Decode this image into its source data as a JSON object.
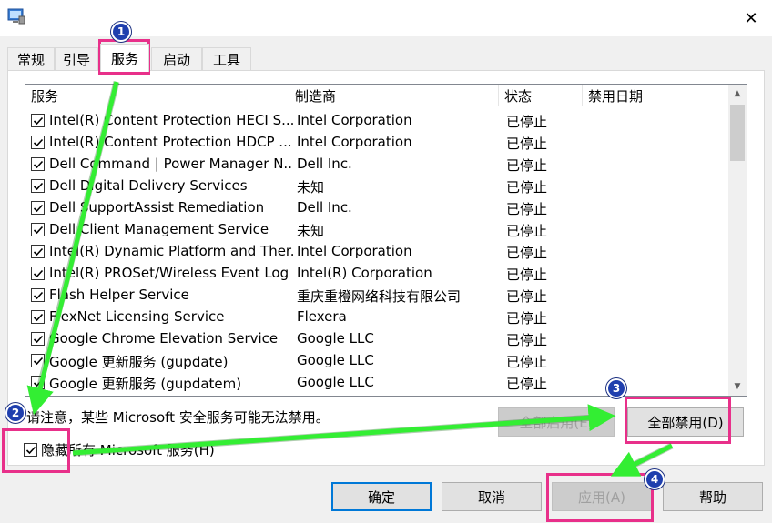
{
  "titlebar": {
    "close_glyph": "✕",
    "icon": "msconfig-icon"
  },
  "tabs": [
    {
      "label": "常规",
      "active": false
    },
    {
      "label": "引导",
      "active": false
    },
    {
      "label": "服务",
      "active": true
    },
    {
      "label": "启动",
      "active": false
    },
    {
      "label": "工具",
      "active": false
    }
  ],
  "list": {
    "columns": [
      "服务",
      "制造商",
      "状态",
      "禁用日期"
    ],
    "rows": [
      {
        "checked": true,
        "service": "Intel(R) Content Protection HECI S...",
        "vendor": "Intel Corporation",
        "status": "已停止",
        "date": ""
      },
      {
        "checked": true,
        "service": "Intel(R) Content Protection HDCP ...",
        "vendor": "Intel Corporation",
        "status": "已停止",
        "date": ""
      },
      {
        "checked": true,
        "service": "Dell Command | Power Manager N...",
        "vendor": "Dell Inc.",
        "status": "已停止",
        "date": ""
      },
      {
        "checked": true,
        "service": "Dell Digital Delivery Services",
        "vendor": "未知",
        "status": "已停止",
        "date": ""
      },
      {
        "checked": true,
        "service": "Dell SupportAssist Remediation",
        "vendor": "Dell Inc.",
        "status": "已停止",
        "date": ""
      },
      {
        "checked": true,
        "service": "Dell Client Management Service",
        "vendor": "未知",
        "status": "已停止",
        "date": ""
      },
      {
        "checked": true,
        "service": "Intel(R) Dynamic Platform and Ther...",
        "vendor": "Intel Corporation",
        "status": "已停止",
        "date": ""
      },
      {
        "checked": true,
        "service": "Intel(R) PROSet/Wireless Event Log",
        "vendor": "Intel(R) Corporation",
        "status": "已停止",
        "date": ""
      },
      {
        "checked": true,
        "service": "Flash Helper Service",
        "vendor": "重庆重橙网络科技有限公司",
        "status": "已停止",
        "date": ""
      },
      {
        "checked": true,
        "service": "FlexNet Licensing Service",
        "vendor": "Flexera",
        "status": "已停止",
        "date": ""
      },
      {
        "checked": true,
        "service": "Google Chrome Elevation Service",
        "vendor": "Google LLC",
        "status": "已停止",
        "date": ""
      },
      {
        "checked": true,
        "service": "Google 更新服务 (gupdate)",
        "vendor": "Google LLC",
        "status": "已停止",
        "date": ""
      },
      {
        "checked": true,
        "service": "Google 更新服务 (gupdatem)",
        "vendor": "Google LLC",
        "status": "已停止",
        "date": ""
      }
    ]
  },
  "note": "请注意，某些 Microsoft 安全服务可能无法禁用。",
  "buttons": {
    "enable_all": "全部启用(E)",
    "disable_all": "全部禁用(D)",
    "ok": "确定",
    "cancel": "取消",
    "apply": "应用(A)",
    "help": "帮助"
  },
  "hide_ms": {
    "label": "隐藏所有 Microsoft 服务(H)",
    "checked": true
  },
  "annotations": [
    "1",
    "2",
    "3",
    "4"
  ],
  "colors": {
    "highlight": "#e8308a",
    "arrow": "#33ee33",
    "badge": "#1f3fae"
  }
}
